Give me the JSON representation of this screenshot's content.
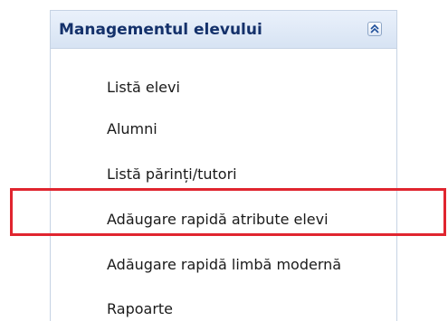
{
  "panel": {
    "title": "Managementul elevului",
    "collapse_icon": "double-chevron-up-icon"
  },
  "menu": {
    "items": [
      {
        "label": "Listă elevi"
      },
      {
        "label": "Alumni"
      },
      {
        "label": "Listă părinți/tutori"
      },
      {
        "label": "Adăugare rapidă atribute elevi"
      },
      {
        "label": "Adăugare rapidă limbă modernă"
      },
      {
        "label": "Rapoarte"
      }
    ]
  },
  "highlight": {
    "color": "#e0252f",
    "target": "Adăugare rapidă atribute elevi"
  }
}
